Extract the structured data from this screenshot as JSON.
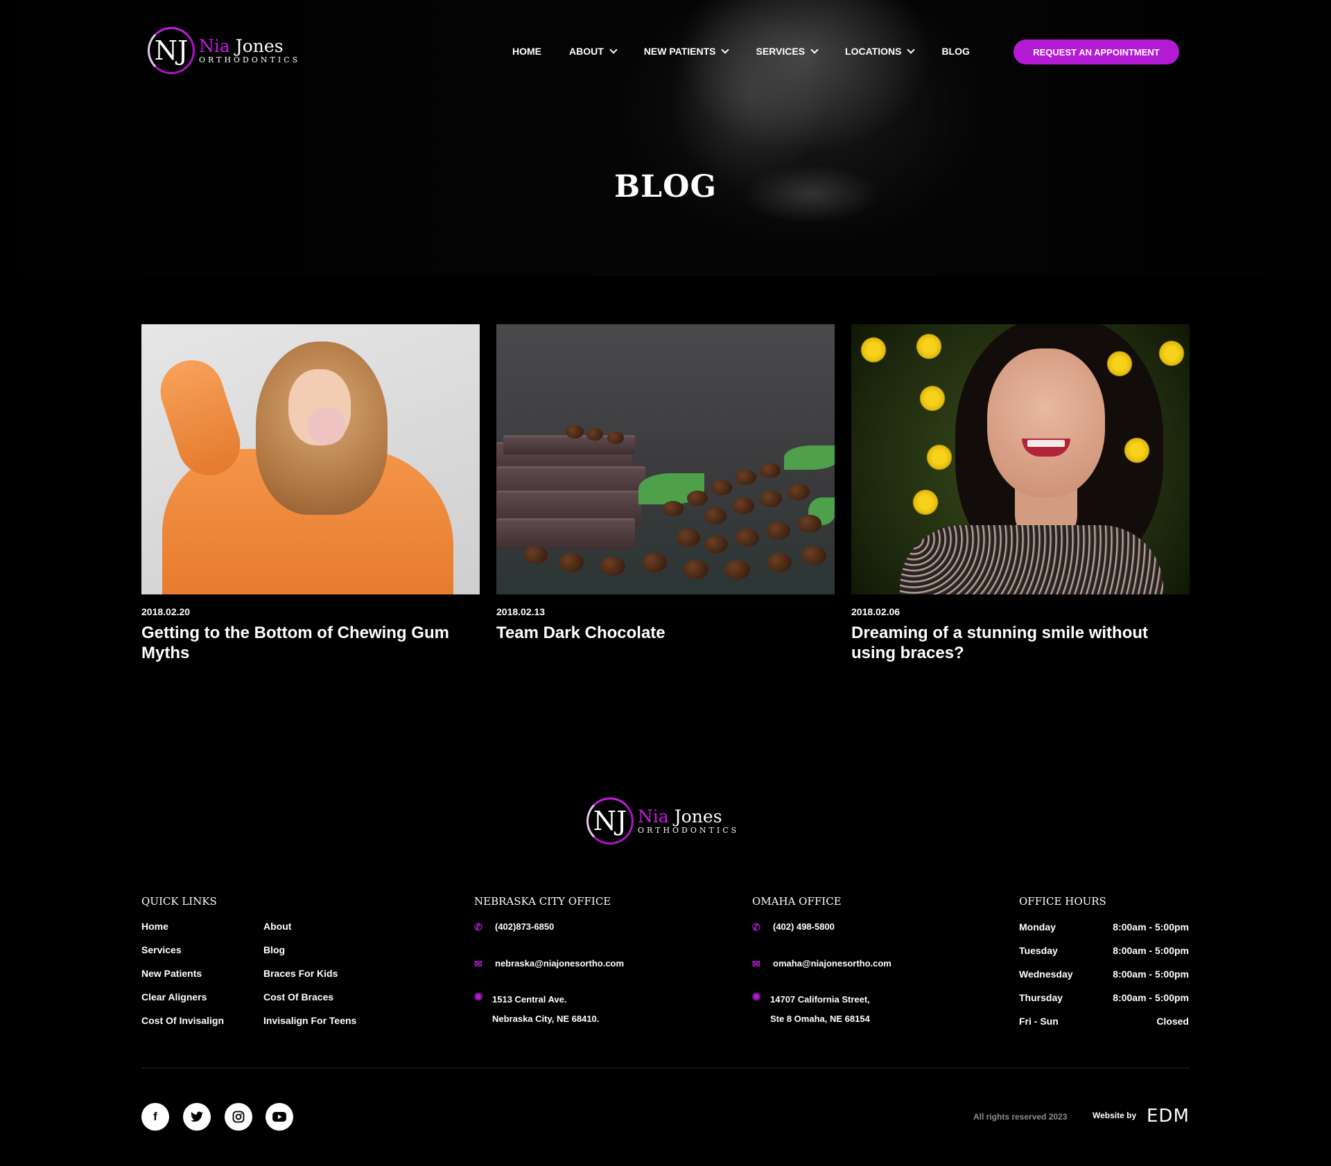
{
  "brand": {
    "mark": "NJ",
    "first": "Nia",
    "last": "Jones",
    "sub": "ORTHODONTICS",
    "accent": "#b31bd4"
  },
  "nav": {
    "items": [
      {
        "label": "HOME",
        "has_dropdown": false
      },
      {
        "label": "ABOUT",
        "has_dropdown": true
      },
      {
        "label": "NEW PATIENTS",
        "has_dropdown": true
      },
      {
        "label": "SERVICES",
        "has_dropdown": true
      },
      {
        "label": "LOCATIONS",
        "has_dropdown": true
      },
      {
        "label": "BLOG",
        "has_dropdown": false
      }
    ],
    "cta": "REQUEST AN APPOINTMENT"
  },
  "hero": {
    "title": "BLOG"
  },
  "posts": [
    {
      "date": "2018.02.20",
      "title": "Getting to the Bottom of Chewing Gum Myths"
    },
    {
      "date": "2018.02.13",
      "title": "Team Dark Chocolate"
    },
    {
      "date": "2018.02.06",
      "title": "Dreaming of a stunning smile without using braces?"
    }
  ],
  "footer": {
    "quick_links": {
      "heading": "QUICK LINKS",
      "col1": [
        "Home",
        "Services",
        "New Patients",
        "Clear Aligners",
        "Cost Of Invisalign"
      ],
      "col2": [
        "About",
        "Blog",
        "Braces For Kids",
        "Cost Of Braces",
        "Invisalign For Teens"
      ]
    },
    "nebraska": {
      "heading": "NEBRASKA CITY OFFICE",
      "phone": "(402)873-6850",
      "email": "nebraska@niajonesortho.com",
      "address_line1": "1513 Central Ave.",
      "address_line2": "Nebraska City, NE 68410."
    },
    "omaha": {
      "heading": "OMAHA OFFICE",
      "phone": "(402) 498-5800",
      "email": "omaha@niajonesortho.com",
      "address_line1": "14707 California Street,",
      "address_line2": "Ste 8 Omaha, NE 68154"
    },
    "hours": {
      "heading": "OFFICE HOURS",
      "rows": [
        {
          "day": "Monday",
          "time": "8:00am - 5:00pm"
        },
        {
          "day": "Tuesday",
          "time": "8:00am - 5:00pm"
        },
        {
          "day": "Wednesday",
          "time": "8:00am - 5:00pm"
        },
        {
          "day": "Thursday",
          "time": "8:00am - 5:00pm"
        },
        {
          "day": "Fri - Sun",
          "time": "Closed"
        }
      ]
    },
    "social_icons": [
      "facebook-icon",
      "twitter-icon",
      "instagram-icon",
      "youtube-icon"
    ],
    "rights": "All rights reserved 2023",
    "website_by": "Website by",
    "agency": "EDM"
  }
}
